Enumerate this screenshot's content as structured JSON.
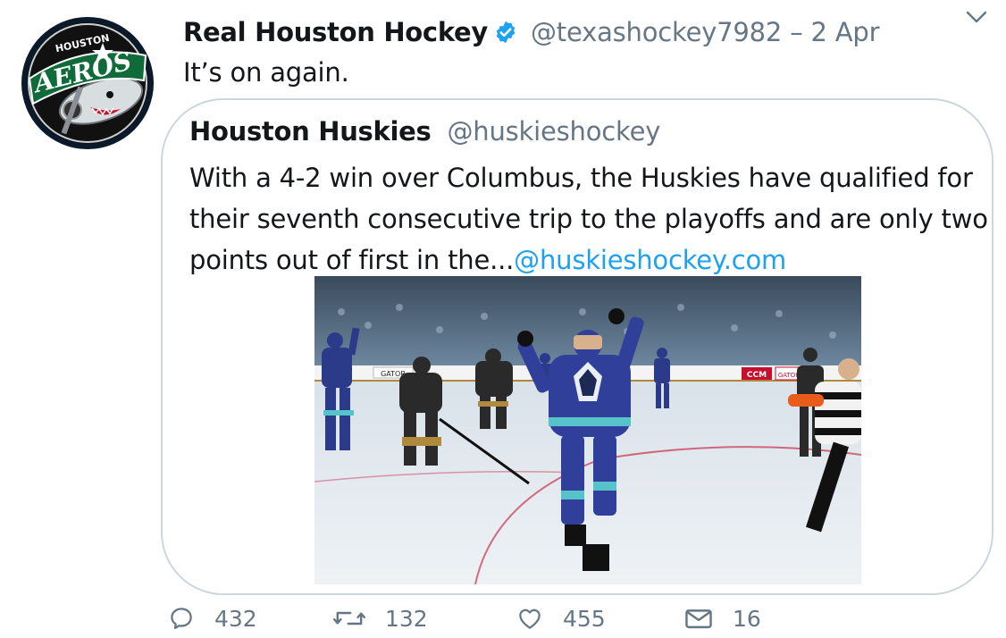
{
  "tweet": {
    "author": {
      "display_name": "Real Houston Hockey",
      "verified": true,
      "handle": "@texashockey7982",
      "timestamp": "2 Apr",
      "handle_time": "@texashockey7982 – 2 Apr",
      "avatar_logo_text": "HOUSTON AEROS"
    },
    "text": "It’s on again.",
    "quoted": {
      "display_name": "Houston Huskies",
      "handle": "@huskieshockey",
      "text": "With a 4-2 win over Columbus, the Huskies have qualified for their seventh consecutive trip to the playoffs and are only two points out of first in the...",
      "link": "@huskieshockey.com",
      "media_signage": [
        "GATOR",
        "CCM",
        "GATOR"
      ]
    },
    "actions": {
      "reply_count": "432",
      "retweet_count": "132",
      "like_count": "455",
      "dm_count": "16"
    }
  },
  "colors": {
    "text_primary": "#14171a",
    "text_secondary": "#657786",
    "link": "#1da1f2",
    "verified": "#1da1f2",
    "border": "#ccd6dd"
  },
  "icons": {
    "verified": "verified-badge-icon",
    "caret": "chevron-down-icon",
    "reply": "reply-icon",
    "retweet": "retweet-icon",
    "like": "heart-icon",
    "dm": "envelope-icon"
  }
}
